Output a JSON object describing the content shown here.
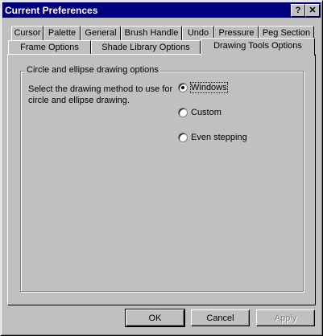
{
  "window": {
    "title": "Current Preferences",
    "help_label": "?",
    "close_label": "✕"
  },
  "tabs_row1": [
    "Cursor",
    "Palette",
    "General",
    "Brush Handle",
    "Undo",
    "Pressure",
    "Peg Section"
  ],
  "tabs_row2": [
    "Frame Options",
    "Shade Library Options",
    "Drawing Tools Options"
  ],
  "active_tab": "Drawing Tools Options",
  "group": {
    "label": "Circle and ellipse drawing options",
    "description": "Select the drawing method to use for circle and ellipse drawing.",
    "options": [
      {
        "label": "Windows",
        "selected": true
      },
      {
        "label": "Custom",
        "selected": false
      },
      {
        "label": "Even stepping",
        "selected": false
      }
    ]
  },
  "buttons": {
    "ok": "OK",
    "cancel": "Cancel",
    "apply": "Apply"
  }
}
